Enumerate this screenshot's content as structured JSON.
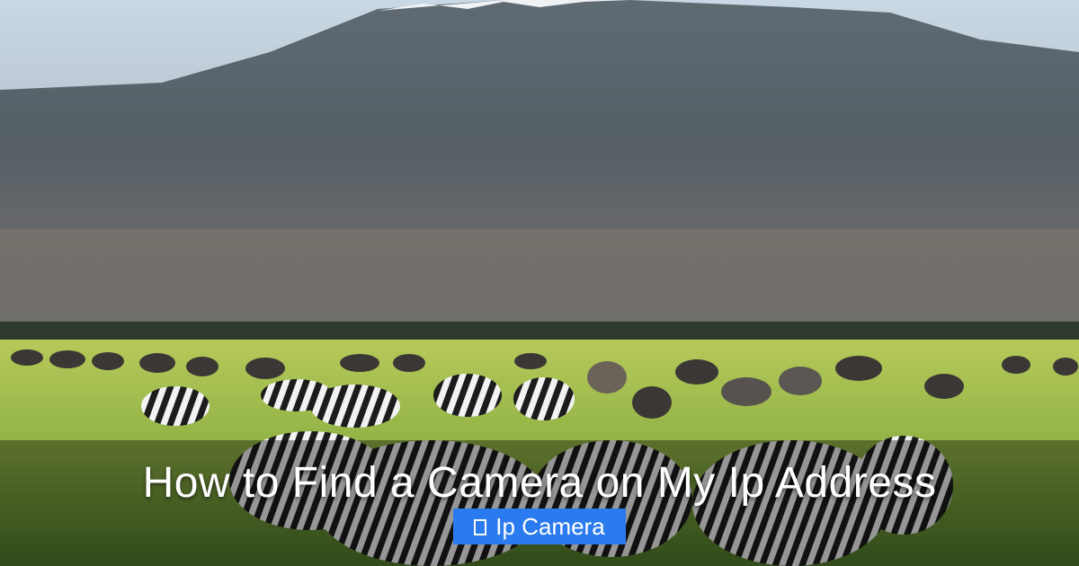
{
  "article": {
    "title": "How to Find a Camera on My Ip Address",
    "category_label": "Ip Camera"
  },
  "icons": {
    "category_icon": "missing-glyph-box-icon"
  },
  "colors": {
    "badge_background": "#2b7bf0",
    "title_text": "#ffffff"
  },
  "image": {
    "subject": "Zebras and wildebeest grazing on savanna grassland in front of a snow-capped mountain"
  }
}
